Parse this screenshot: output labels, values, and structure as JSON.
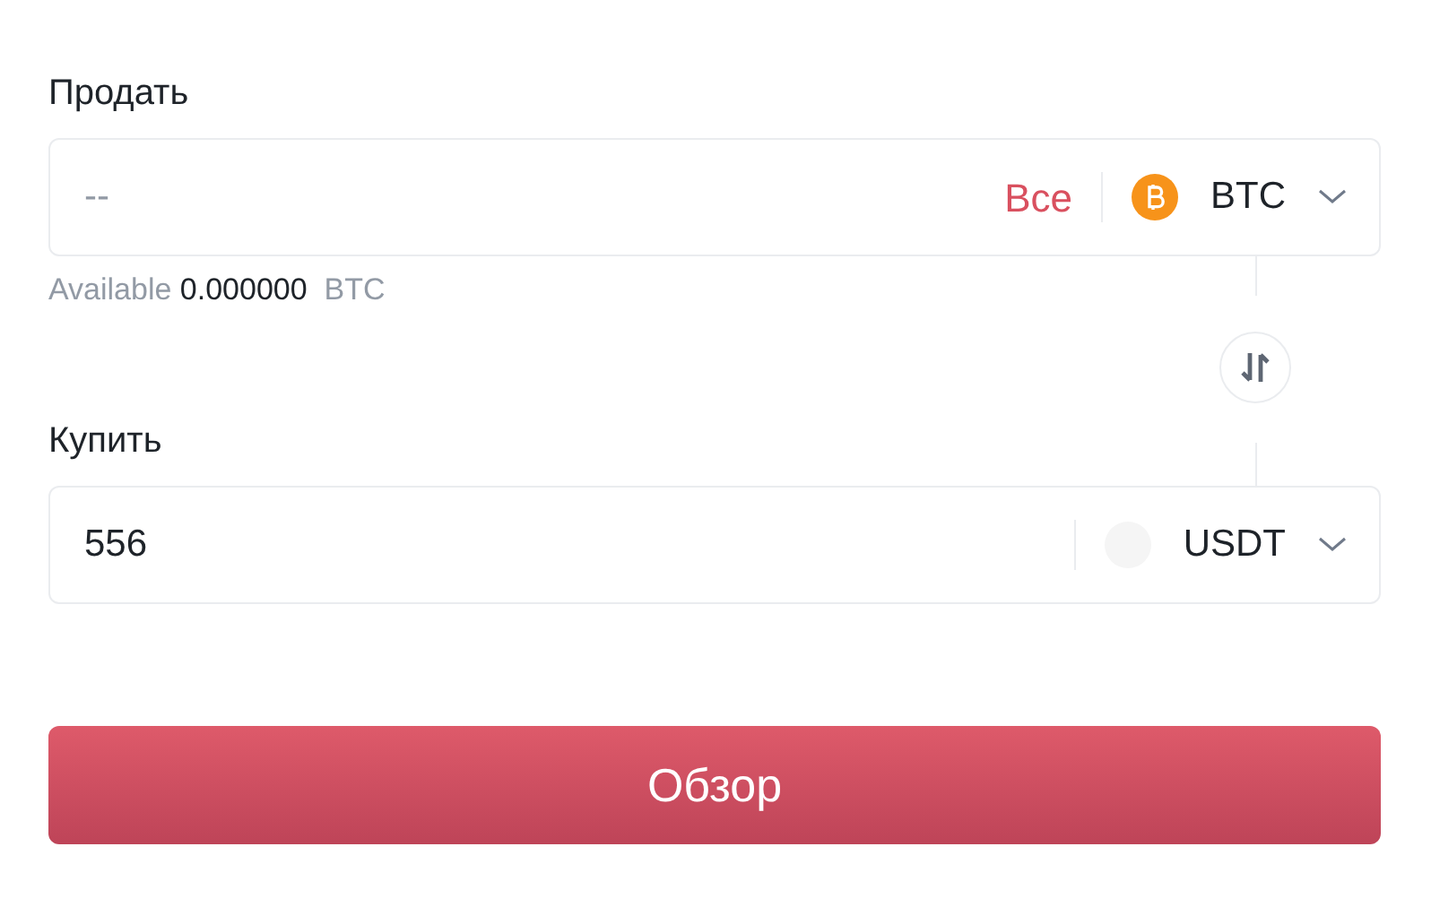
{
  "sell": {
    "label": "Продать",
    "placeholder": "--",
    "max_link": "Все",
    "coin": {
      "symbol": "BTC",
      "kind": "bitcoin"
    }
  },
  "available": {
    "label": "Available",
    "amount": "0.000000",
    "unit": "BTC"
  },
  "buy": {
    "label": "Купить",
    "value": "556",
    "coin": {
      "symbol": "USDT",
      "kind": "blank"
    }
  },
  "submit": "Обзор"
}
